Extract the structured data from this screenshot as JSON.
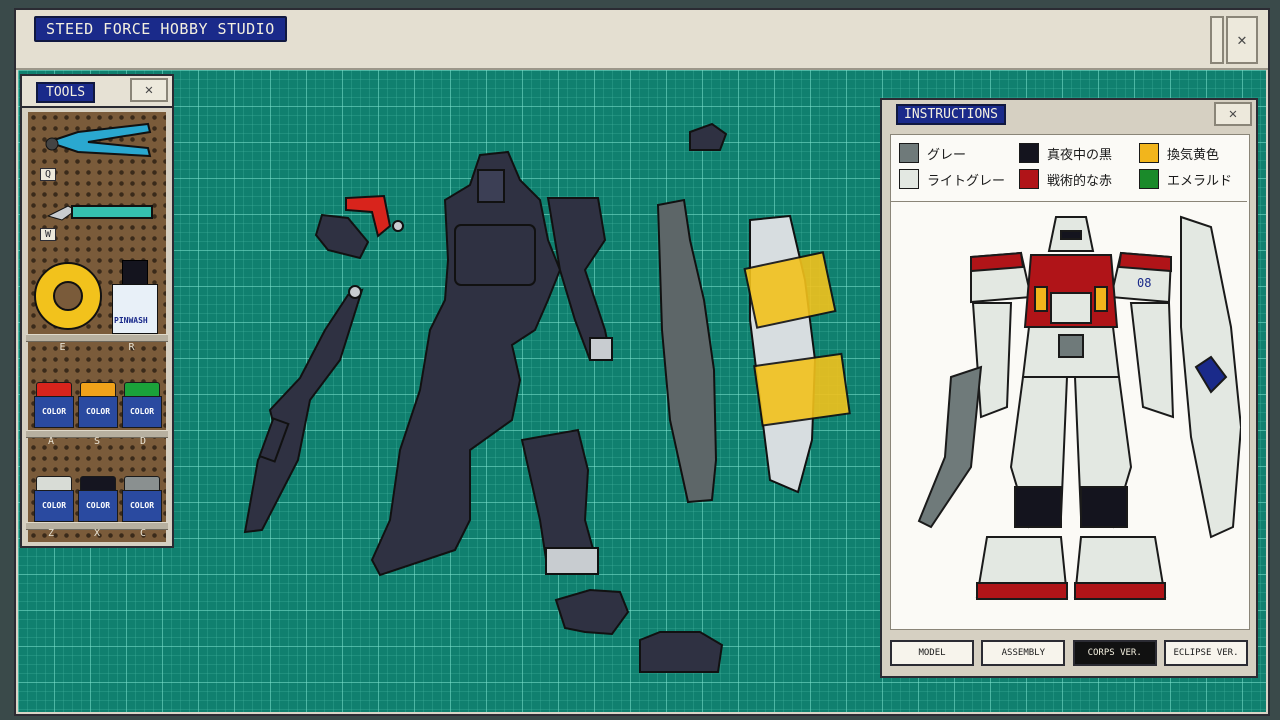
{
  "window": {
    "title": "STEED FORCE HOBBY STUDIO",
    "close": "✕"
  },
  "tools": {
    "title": "TOOLS",
    "close": "✕",
    "keys": {
      "nippers": "Q",
      "knife": "W"
    },
    "row1_keys": [
      "E",
      "R"
    ],
    "row2_keys": [
      "A",
      "S",
      "D"
    ],
    "row3_keys": [
      "Z",
      "X",
      "C"
    ],
    "pinwash_label": "PINWASH",
    "paint_label": "COLOR",
    "paints_row2": [
      "#d8241c",
      "#f0a21a",
      "#1aa23a"
    ],
    "paints_row3": [
      "#d8dcd6",
      "#151520",
      "#8a9090"
    ]
  },
  "instructions": {
    "title": "INSTRUCTIONS",
    "close": "✕",
    "legend": [
      {
        "name": "グレー",
        "color": "#6f7a7a"
      },
      {
        "name": "真夜中の黒",
        "color": "#14141e"
      },
      {
        "name": "換気黄色",
        "color": "#f2b51c"
      },
      {
        "name": "ライトグレー",
        "color": "#e3e8e2"
      },
      {
        "name": "戦術的な赤",
        "color": "#b01418"
      },
      {
        "name": "エメラルド",
        "color": "#1a8a2a"
      }
    ],
    "tabs": [
      "MODEL",
      "ASSEMBLY",
      "CORPS VER.",
      "ECLIPSE VER."
    ],
    "active_tab": "CORPS VER.",
    "shoulder_number": "08"
  },
  "colors": {
    "mat": "#10806f",
    "part_dark": "#2f3142",
    "part_grey": "#5d6668",
    "tape": "#f2c21c",
    "accent_blue": "#1a2a8a"
  }
}
